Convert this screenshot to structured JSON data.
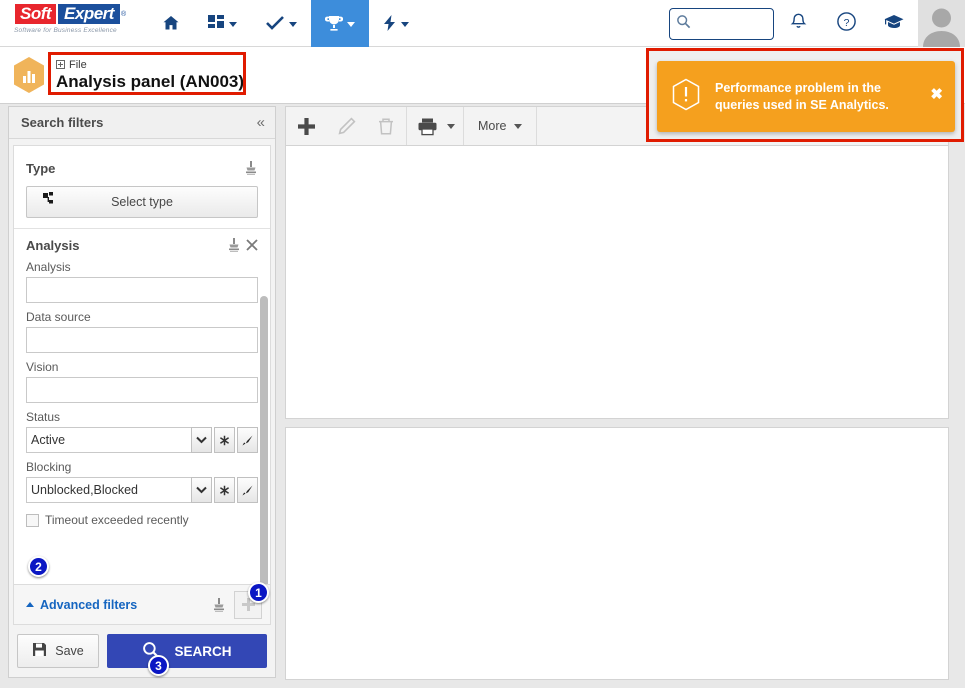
{
  "brand": {
    "logo_soft": "Soft",
    "logo_expert": "Expert",
    "logo_reg": "®",
    "tagline": "Software for Business Excellence"
  },
  "colors": {
    "nav_blue": "#17457f",
    "nav_active_bg": "#3d8ddb",
    "accent_blue": "#3347b5",
    "warning_orange": "#f5a01e",
    "highlight_red": "#e01b00",
    "badge_blue": "#0b17c4",
    "hex_orange": "#f0b45a"
  },
  "topnav": {
    "items": [
      {
        "name": "home",
        "icon": "home-icon",
        "has_caret": false,
        "active": false
      },
      {
        "name": "dashboard",
        "icon": "grid-icon",
        "has_caret": true,
        "active": false
      },
      {
        "name": "tasks",
        "icon": "check-icon",
        "has_caret": true,
        "active": false
      },
      {
        "name": "quality",
        "icon": "trophy-icon",
        "has_caret": true,
        "active": true
      },
      {
        "name": "quick-actions",
        "icon": "bolt-icon",
        "has_caret": true,
        "active": false
      }
    ],
    "search": {
      "value": "",
      "placeholder": ""
    },
    "right_icons": [
      {
        "name": "notifications",
        "icon": "bell-icon"
      },
      {
        "name": "help",
        "icon": "question-circle-icon"
      },
      {
        "name": "academy",
        "icon": "graduation-cap-icon"
      }
    ]
  },
  "pagehead": {
    "module_icon": "bar-chart-hexagon-icon",
    "breadcrumb": "File",
    "title": "Analysis panel (AN003)"
  },
  "toast": {
    "icon": "warning-hexagon-icon",
    "message": "Performance problem in the queries used in SE Analytics.",
    "close_label": "✖"
  },
  "filters": {
    "header": "Search filters",
    "collapse_icon": "«",
    "type_section": {
      "label": "Type",
      "clear_icon": "broom-icon",
      "select_button": "Select type",
      "select_button_icon": "tree-structure-icon"
    },
    "analysis_section": {
      "label": "Analysis",
      "clear_icon": "broom-icon",
      "remove_icon": "close-icon",
      "fields": [
        {
          "label": "Analysis",
          "value": "",
          "placeholder": "",
          "type": "text"
        },
        {
          "label": "Data source",
          "value": "",
          "placeholder": "",
          "type": "text"
        },
        {
          "label": "Vision",
          "value": "",
          "placeholder": "",
          "type": "text"
        },
        {
          "label": "Status",
          "value": "Active",
          "type": "combo"
        },
        {
          "label": "Blocking",
          "value": "Unblocked,Blocked",
          "type": "combo"
        }
      ],
      "checkbox": {
        "label": "Timeout exceeded recently",
        "checked": false
      }
    },
    "advanced": {
      "label": "Advanced filters",
      "clear_icon": "broom-icon",
      "add_icon": "plus-icon"
    },
    "footer": {
      "save_label": "Save",
      "save_icon": "floppy-disk-icon",
      "search_label": "SEARCH",
      "search_icon": "magnifier-icon"
    }
  },
  "toolbar": {
    "buttons": [
      {
        "name": "add",
        "icon": "plus-icon",
        "enabled": true
      },
      {
        "name": "edit",
        "icon": "pencil-icon",
        "enabled": false
      },
      {
        "name": "delete",
        "icon": "trash-icon",
        "enabled": false
      }
    ],
    "print": {
      "name": "print",
      "icon": "printer-icon",
      "has_caret": true
    },
    "more": {
      "label": "More",
      "has_caret": true
    }
  },
  "badges": [
    {
      "number": "1",
      "target": "add-filter-button"
    },
    {
      "number": "2",
      "target": "timeout-checkbox"
    },
    {
      "number": "3",
      "target": "search-button"
    }
  ]
}
